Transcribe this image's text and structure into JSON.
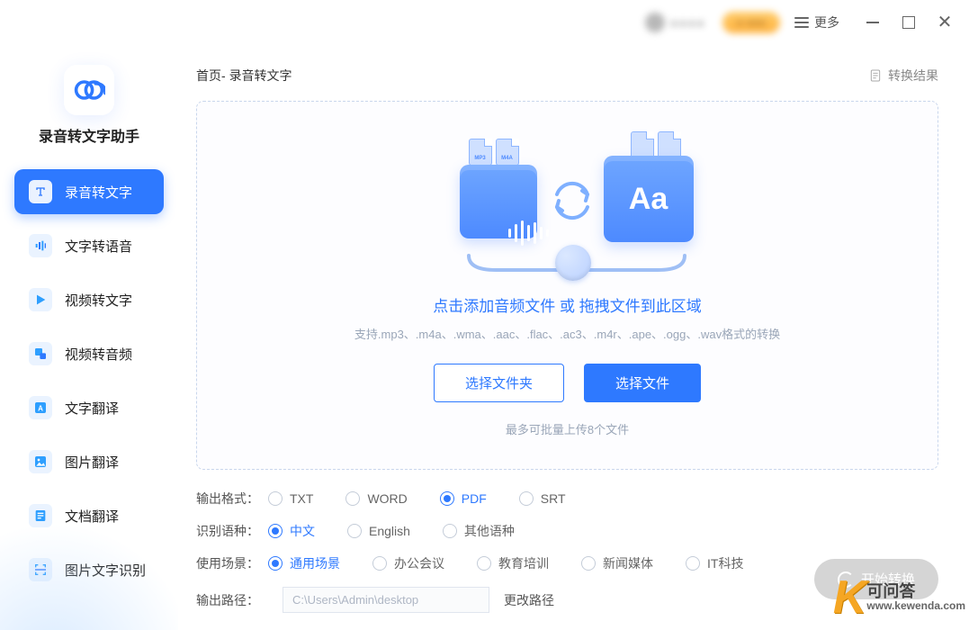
{
  "titlebar": {
    "user_name_masked": "●●●●",
    "promo_label": "● ●●●",
    "more_label": "更多"
  },
  "brand": {
    "name": "录音转文字助手"
  },
  "nav": {
    "items": [
      {
        "label": "录音转文字",
        "active": true
      },
      {
        "label": "文字转语音",
        "active": false
      },
      {
        "label": "视频转文字",
        "active": false
      },
      {
        "label": "视频转音频",
        "active": false
      },
      {
        "label": "文字翻译",
        "active": false
      },
      {
        "label": "图片翻译",
        "active": false
      },
      {
        "label": "文档翻译",
        "active": false
      },
      {
        "label": "图片文字识别",
        "active": false
      }
    ]
  },
  "crumb": {
    "home": "首页",
    "current": "录音转文字",
    "result": "转换结果"
  },
  "dropzone": {
    "title_a": "点击添加音频文件",
    "title_b": "或",
    "title_c": "拖拽文件到此区域",
    "sub": "支持.mp3、.m4a、.wma、.aac、.flac、.ac3、.m4r、.ape、.ogg、.wav格式的转换",
    "select_folder": "选择文件夹",
    "select_file": "选择文件",
    "note": "最多可批量上传8个文件",
    "illus_aa": "Aa",
    "illus_file_mp3": "MP3",
    "illus_file_m4a": "M4A"
  },
  "options": {
    "format": {
      "label": "输出格式：",
      "items": [
        "TXT",
        "WORD",
        "PDF",
        "SRT"
      ],
      "selected": "PDF"
    },
    "language": {
      "label": "识别语种：",
      "items": [
        "中文",
        "English",
        "其他语种"
      ],
      "selected": "中文"
    },
    "scene": {
      "label": "使用场景：",
      "items": [
        "通用场景",
        "办公会议",
        "教育培训",
        "新闻媒体",
        "IT科技"
      ],
      "selected": "通用场景"
    },
    "output_path": {
      "label": "输出路径：",
      "value": "C:\\Users\\Admin\\desktop",
      "change_label": "更改路径"
    }
  },
  "start": {
    "label": "开始转换"
  },
  "watermark": {
    "k": "K",
    "line1": "可问答",
    "line2": "www.kewenda.com"
  }
}
